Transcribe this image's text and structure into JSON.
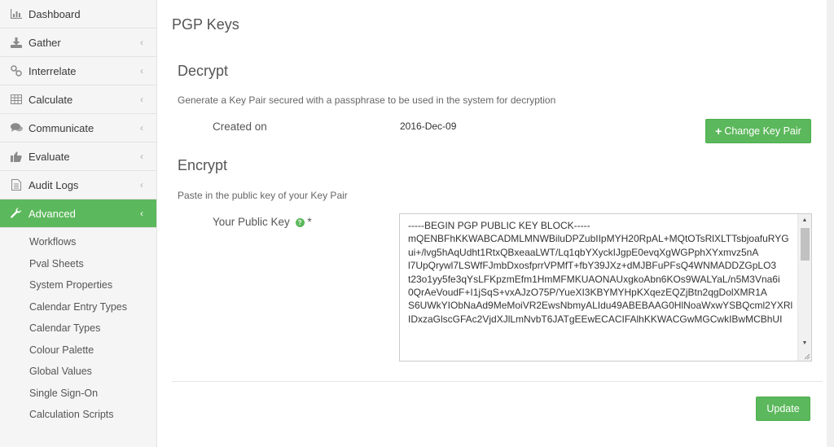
{
  "sidebar": {
    "items": [
      {
        "label": "Dashboard",
        "icon": "bar-chart-icon",
        "has_chevron": false
      },
      {
        "label": "Gather",
        "icon": "download-icon",
        "has_chevron": true
      },
      {
        "label": "Interrelate",
        "icon": "link-icon",
        "has_chevron": true
      },
      {
        "label": "Calculate",
        "icon": "table-icon",
        "has_chevron": true
      },
      {
        "label": "Communicate",
        "icon": "comments-icon",
        "has_chevron": true
      },
      {
        "label": "Evaluate",
        "icon": "thumbs-up-icon",
        "has_chevron": true
      },
      {
        "label": "Audit Logs",
        "icon": "document-icon",
        "has_chevron": true
      },
      {
        "label": "Advanced",
        "icon": "wrench-icon",
        "has_chevron": true,
        "active": true
      }
    ],
    "subitems": [
      "Workflows",
      "Pval Sheets",
      "System Properties",
      "Calendar Entry Types",
      "Calendar Types",
      "Colour Palette",
      "Global Values",
      "Single Sign-On",
      "Calculation Scripts"
    ],
    "chevron_glyph": "‹",
    "accent_color": "#5cb85c"
  },
  "main": {
    "page_title": "PGP Keys",
    "decrypt": {
      "title": "Decrypt",
      "help": "Generate a Key Pair secured with a passphrase to be used in the system for decryption",
      "created_label": "Created on",
      "created_value": "2016-Dec-09",
      "change_button": "Change Key Pair",
      "change_icon": "plus-icon"
    },
    "encrypt": {
      "title": "Encrypt",
      "help": "Paste in the public key of your Key Pair",
      "public_key_label": "Your Public Key",
      "required_mark": "*",
      "help_icon": "question-icon",
      "public_key_value": "-----BEGIN PGP PUBLIC KEY BLOCK-----\nmQENBFhKKWABCADMLMNWBiluDPZubIIpMYH20RpAL+MQtOTsRlXLTTsbjoafuRYG\nui+/lvg5hAqUdht1RtxQBxeaaLWT/Lq1qbYXyckIJgpE0evqXgWGPphXYxmvz5nA\nl7UpQrywl7LSWfFJmbDxosfprrVPMfT+fbY39JXz+dMJBFuPFsQ4WNMADDZGpLO3\nt23o1yy5fe3qYsLFKpzmEfm1HmMFMKUAONAUxgkoAbn6KOs9WALYaL/n5M3Vna6i\n0QrAeVoudF+I1jSqS+vxAJzO75P/YueXI3KBYMYHpKXqezEQZjBtn2qgDolXMR1A\nS6UWkYIObNaAd9MeMoiVR2EwsNbmyALIdu49ABEBAAG0HlNoaWxwYSBQcml2YXRl\nIDxzaGlscGFAc2VjdXJlLmNvbT6JATgEEwECACIFAlhKKWACGwMGCwkIBwMCBhUI"
    },
    "update_button": "Update"
  }
}
